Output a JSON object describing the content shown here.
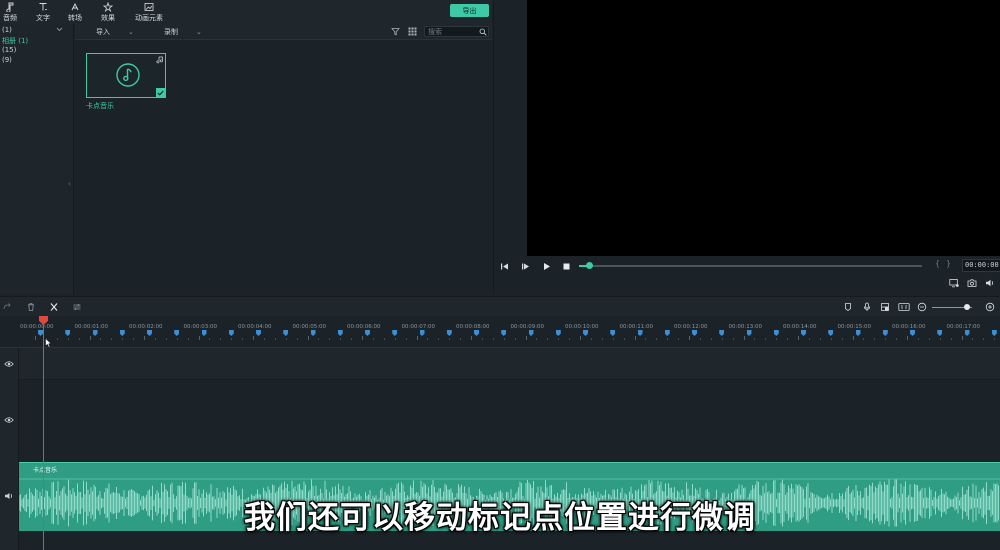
{
  "toolbar": {
    "items": [
      {
        "label": "音频",
        "icon": "music-note-icon"
      },
      {
        "label": "文字",
        "icon": "text-icon"
      },
      {
        "label": "转场",
        "icon": "transition-icon"
      },
      {
        "label": "效果",
        "icon": "effects-icon"
      },
      {
        "label": "动画元素",
        "icon": "animated-element-icon"
      }
    ],
    "export_label": "导出"
  },
  "categories": [
    {
      "label": "(1)"
    },
    {
      "label": "相册 (1)",
      "active": true
    },
    {
      "label": "(15)"
    },
    {
      "label": "(9)"
    }
  ],
  "media_bar": {
    "import_label": "导入",
    "record_label": "录制",
    "search_placeholder": "搜索"
  },
  "media_item": {
    "label": "卡点音乐"
  },
  "preview": {
    "timecode": "00:00:00:00",
    "progress": 0.03,
    "mark_in": "{",
    "mark_out": "}"
  },
  "timeline": {
    "ruler_labels": [
      "00:00:00:00",
      "00:00:01:00",
      "00:00:02:00",
      "00:00:03:00",
      "00:00:04:00",
      "00:00:05:00",
      "00:00:06:00",
      "00:00:07:00",
      "00:00:08:00",
      "00:00:09:00",
      "00:00:10:00",
      "00:00:11:00",
      "00:00:12:00",
      "00:00:13:00",
      "00:00:14:00",
      "00:00:15:00",
      "00:00:16:00",
      "00:00:17:00"
    ],
    "zoom_level": 0.88,
    "audio_clip_label": "卡点音乐"
  },
  "subtitle": "我们还可以移动标记点位置进行微调",
  "colors": {
    "accent": "#3ec9a7",
    "playhead": "#e0473e",
    "beat_marker": "#3a8fd6",
    "audio_clip": "#2f9c84"
  }
}
